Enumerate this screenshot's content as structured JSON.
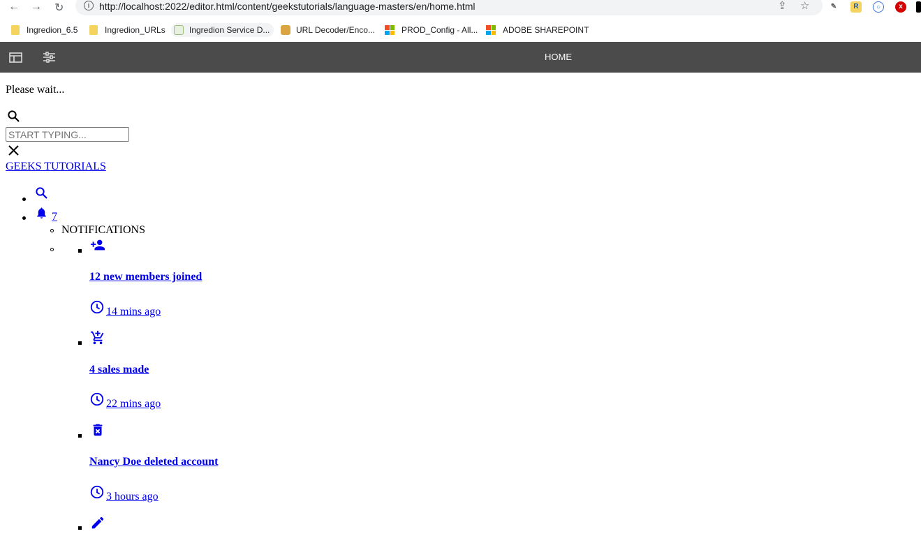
{
  "browser": {
    "url": "http://localhost:2022/editor.html/content/geekstutorials/language-masters/en/home.html",
    "bookmarks": [
      {
        "label": "Ingredion_6.5",
        "icon": "folder-icon"
      },
      {
        "label": "Ingredion_URLs",
        "icon": "folder-icon"
      },
      {
        "label": "Ingredion Service D...",
        "icon": "site-favicon"
      },
      {
        "label": "URL Decoder/Enco...",
        "icon": "site-favicon"
      },
      {
        "label": "PROD_Config - All...",
        "icon": "microsoft-icon"
      },
      {
        "label": "ADOBE SHAREPOINT",
        "icon": "microsoft-icon"
      }
    ]
  },
  "appbar": {
    "title": "HOME"
  },
  "page": {
    "loading_text": "Please wait...",
    "search_placeholder": "START TYPING...",
    "brand": "GEEKS TUTORIALS",
    "notification_count": "7",
    "notifications_title": "NOTIFICATIONS",
    "notifications": [
      {
        "icon": "person-add-icon",
        "title": "12 new members joined",
        "time": " 14 mins ago"
      },
      {
        "icon": "add-shopping-cart-icon",
        "title": "4 sales made",
        "time": " 22 mins ago"
      },
      {
        "icon": "delete-forever-icon",
        "title": "Nancy Doe deleted account",
        "time": " 3 hours ago"
      },
      {
        "icon": "edit-pencil-icon",
        "title": "",
        "time": ""
      }
    ]
  },
  "colors": {
    "link": "#0000ee",
    "appbar_bg": "#4b4b4b",
    "omnibox_bg": "#f1f3f4"
  }
}
